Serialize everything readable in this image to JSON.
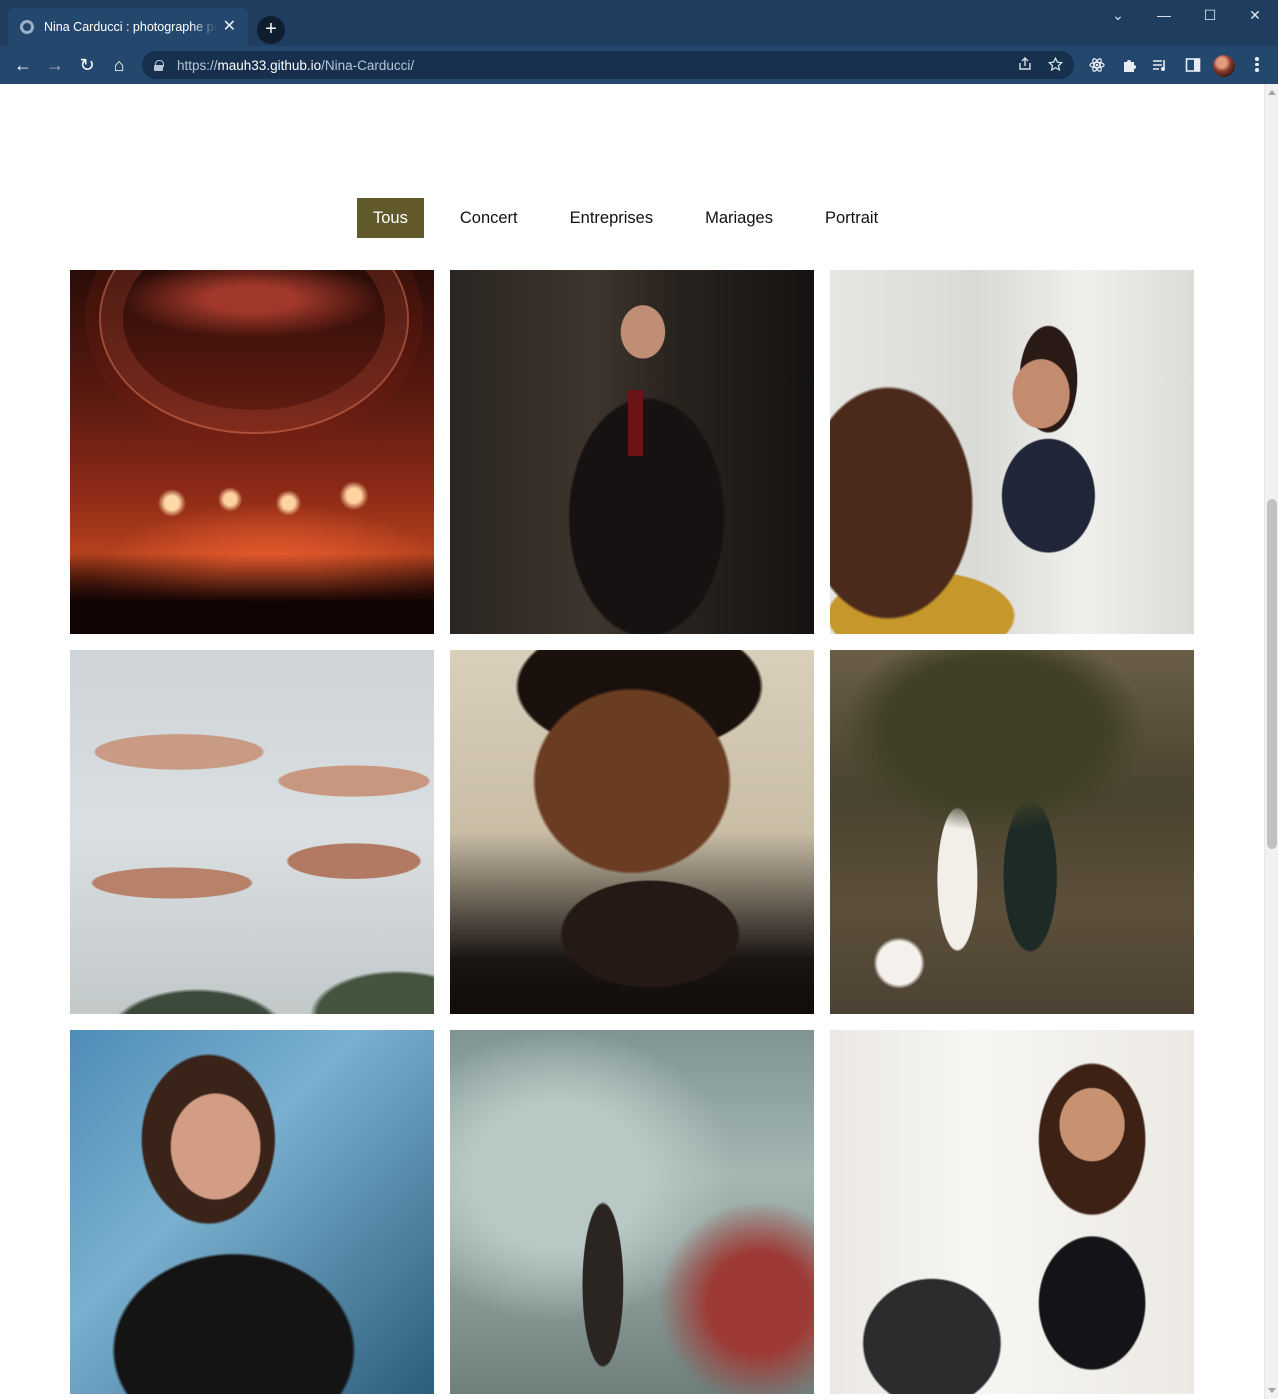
{
  "browser": {
    "tab_title": "Nina Carducci : photographe pas",
    "tab_close": "✕",
    "new_tab": "+",
    "url_scheme": "https://",
    "url_host": "mauh33.github.io",
    "url_path": "/Nina-Carducci/",
    "window_controls": [
      "⌄",
      "—",
      "☐",
      "✕"
    ],
    "nav": {
      "back": "←",
      "forward": "→",
      "reload": "↻",
      "home": "⌂"
    },
    "omnibox_icons": [
      "share-icon",
      "star-icon"
    ],
    "extension_icons": [
      "react-devtools-icon",
      "puzzle-extensions-icon",
      "media-queue-icon",
      "side-panel-icon"
    ]
  },
  "filters": {
    "items": [
      "Tous",
      "Concert",
      "Entreprises",
      "Mariages",
      "Portrait"
    ],
    "active": "Tous",
    "active_color": "#635a2b"
  },
  "gallery": {
    "items": [
      {
        "name": "concert-crowd-photo",
        "category": "Concert"
      },
      {
        "name": "businessman-portrait-photo",
        "category": "Entreprises"
      },
      {
        "name": "office-meeting-photo",
        "category": "Entreprises"
      },
      {
        "name": "hands-wedding-ring-photo",
        "category": "Mariages"
      },
      {
        "name": "man-closed-eyes-portrait-photo",
        "category": "Portrait"
      },
      {
        "name": "wedding-couple-palm-photo",
        "category": "Mariages"
      },
      {
        "name": "woman-glasses-portrait-photo",
        "category": "Portrait"
      },
      {
        "name": "concert-smoke-performer-photo",
        "category": "Concert"
      },
      {
        "name": "woman-laughing-laptop-photo",
        "category": "Entreprises"
      }
    ]
  }
}
